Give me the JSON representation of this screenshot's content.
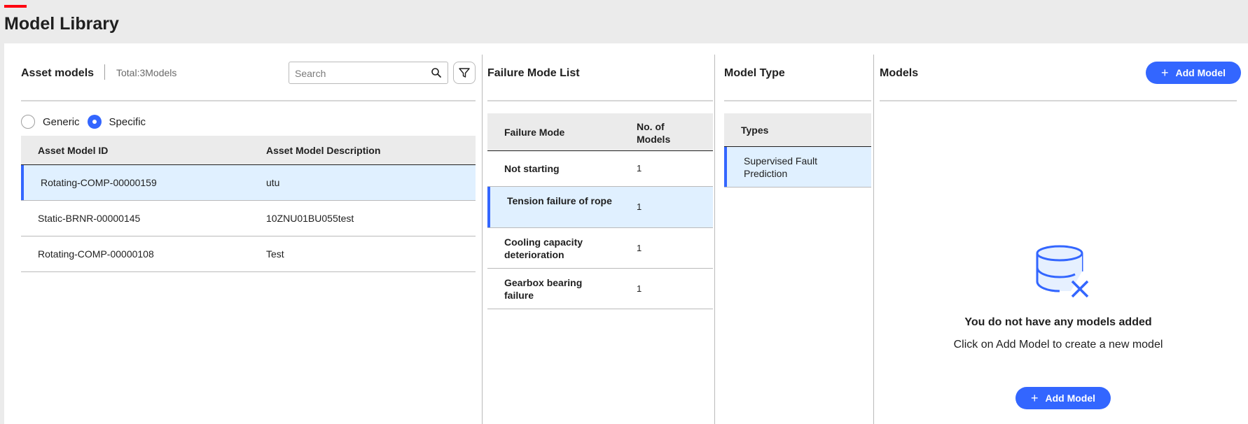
{
  "page": {
    "title": "Model Library"
  },
  "asset_models": {
    "title": "Asset models",
    "total": "Total:3Models",
    "search": {
      "placeholder": "Search",
      "value": ""
    },
    "radio": {
      "generic_label": "Generic",
      "specific_label": "Specific",
      "selected": "Specific"
    },
    "columns": [
      "Asset Model ID",
      "Asset Model Description"
    ],
    "rows": [
      {
        "id": "Rotating-COMP-00000159",
        "description": "utu",
        "selected": true
      },
      {
        "id": "Static-BRNR-00000145",
        "description": "10ZNU01BU055test",
        "selected": false
      },
      {
        "id": "Rotating-COMP-00000108",
        "description": "Test",
        "selected": false
      }
    ]
  },
  "failure_modes": {
    "title": "Failure Mode List",
    "columns": {
      "mode": "Failure Mode",
      "count": "No. of Models"
    },
    "rows": [
      {
        "mode": "Not starting",
        "count": "1",
        "selected": false
      },
      {
        "mode": "Tension failure of rope",
        "count": "1",
        "selected": true
      },
      {
        "mode": "Cooling capacity deterioration",
        "count": "1",
        "selected": false
      },
      {
        "mode": "Gearbox bearing failure",
        "count": "1",
        "selected": false
      }
    ]
  },
  "model_type": {
    "title": "Model Type",
    "column": "Types",
    "rows": [
      {
        "type": "Supervised Fault Prediction",
        "selected": true
      }
    ]
  },
  "models": {
    "title": "Models",
    "add_button": "Add Model",
    "empty": {
      "title": "You do not have any models added",
      "subtitle": "Click on Add Model to create a new model",
      "button": "Add Model"
    }
  },
  "colors": {
    "accent": "#3366ff",
    "brand": "#ff000f",
    "selected_row": "#e0f0ff"
  }
}
